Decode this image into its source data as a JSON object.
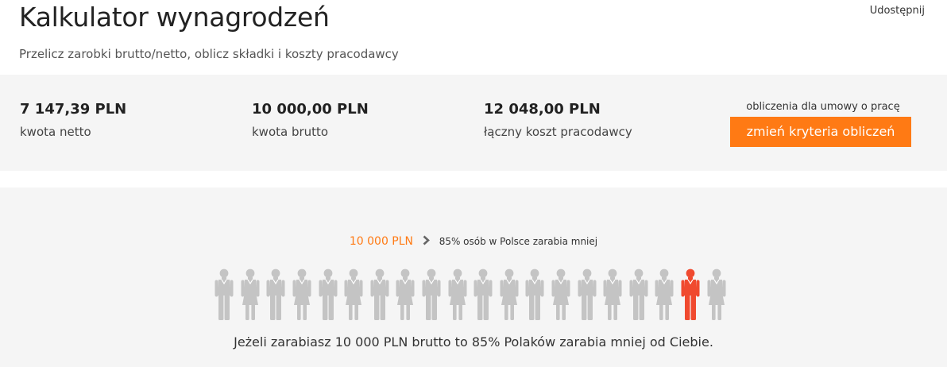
{
  "header": {
    "title": "Kalkulator wynagrodzeń",
    "subtitle": "Przelicz zarobki brutto/netto, oblicz składki i koszty pracodawcy",
    "share_label": "Udostępnij"
  },
  "summary": {
    "net": {
      "value": "7 147,39 PLN",
      "label": "kwota netto"
    },
    "gross": {
      "value": "10 000,00 PLN",
      "label": "kwota brutto"
    },
    "cost": {
      "value": "12 048,00 PLN",
      "label": "łączny koszt pracodawcy"
    },
    "criteria_note": "obliczenia dla umowy o pracę",
    "criteria_button": "zmień kryteria obliczeń"
  },
  "comparison": {
    "amount": "10 000 PLN",
    "percent_text": "85% osób w Polsce zarabia mniej",
    "sentence_prefix": "Jeżeli zarabiasz 10 000 PLN brutto to ",
    "sentence_percent": "85%",
    "sentence_suffix": " Polaków zarabia mniej od Ciebie.",
    "people_total": 20,
    "highlight_index": 18,
    "colors": {
      "neutral": "#c4c4c4",
      "highlight": "#f04a2f",
      "accent": "#ff7a14"
    }
  }
}
